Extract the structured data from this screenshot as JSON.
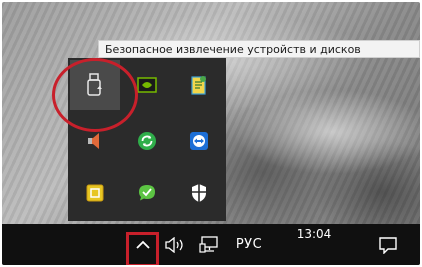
{
  "tooltip": {
    "text": "Безопасное извлечение устройств и дисков"
  },
  "flyout": {
    "icons": [
      "usb-eject-icon",
      "nvidia-icon",
      "notepad-app-icon",
      "speaker-muted-icon",
      "sync-refresh-icon",
      "teamviewer-icon",
      "note-app-icon",
      "green-chat-icon",
      "security-shield-icon"
    ]
  },
  "taskbar": {
    "language": "РУС",
    "time": "13:04",
    "icons": [
      "chevron-up-icon",
      "volume-icon",
      "network-icon",
      "notification-icon"
    ]
  },
  "colors": {
    "highlight": "#c8202b",
    "taskbar": "#101010",
    "flyout": "#2b2b2b"
  }
}
